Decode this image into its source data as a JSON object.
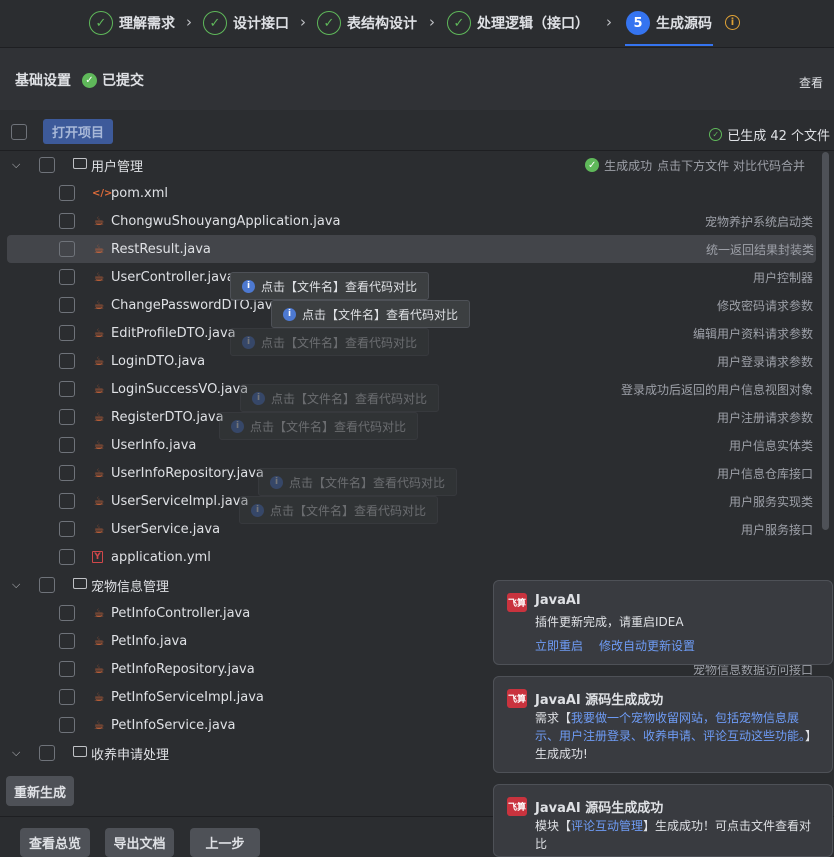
{
  "stepper": {
    "steps": [
      {
        "label": "理解需求",
        "state": "done"
      },
      {
        "label": "设计接口",
        "state": "done"
      },
      {
        "label": "表结构设计",
        "state": "done"
      },
      {
        "label": "处理逻辑（接口）",
        "state": "done"
      },
      {
        "label": "生成源码",
        "state": "active",
        "number": "5"
      }
    ],
    "check_glyph": "✓",
    "arrow_glyph": "›",
    "info_glyph": "i"
  },
  "settings": {
    "title": "基础设置",
    "status": "已提交",
    "view_link": "查看"
  },
  "toolbar": {
    "open_project": "打开项目",
    "generated_count": "已生成 42 个文件"
  },
  "groups": [
    {
      "name": "用户管理",
      "status": "生成成功",
      "hint": "点击下方文件 对比代码合并",
      "files": [
        {
          "name": "pom.xml",
          "type": "xml",
          "desc": ""
        },
        {
          "name": "ChongwuShouyangApplication.java",
          "type": "java",
          "desc": "宠物养护系统启动类"
        },
        {
          "name": "RestResult.java",
          "type": "java",
          "desc": "统一返回结果封装类",
          "selected": true
        },
        {
          "name": "UserController.java",
          "type": "java",
          "desc": "用户控制器"
        },
        {
          "name": "ChangePasswordDTO.java",
          "type": "java",
          "desc": "修改密码请求参数"
        },
        {
          "name": "EditProfileDTO.java",
          "type": "java",
          "desc": "编辑用户资料请求参数"
        },
        {
          "name": "LoginDTO.java",
          "type": "java",
          "desc": "用户登录请求参数"
        },
        {
          "name": "LoginSuccessVO.java",
          "type": "java",
          "desc": "登录成功后返回的用户信息视图对象"
        },
        {
          "name": "RegisterDTO.java",
          "type": "java",
          "desc": "用户注册请求参数"
        },
        {
          "name": "UserInfo.java",
          "type": "java",
          "desc": "用户信息实体类"
        },
        {
          "name": "UserInfoRepository.java",
          "type": "java",
          "desc": "用户信息仓库接口"
        },
        {
          "name": "UserServiceImpl.java",
          "type": "java",
          "desc": "用户服务实现类"
        },
        {
          "name": "UserService.java",
          "type": "java",
          "desc": "用户服务接口"
        },
        {
          "name": "application.yml",
          "type": "yml",
          "desc": ""
        }
      ]
    },
    {
      "name": "宠物信息管理",
      "files": [
        {
          "name": "PetInfoController.java",
          "type": "java",
          "desc": ""
        },
        {
          "name": "PetInfo.java",
          "type": "java",
          "desc": ""
        },
        {
          "name": "PetInfoRepository.java",
          "type": "java",
          "desc": "宠物信息数据访问接口"
        },
        {
          "name": "PetInfoServiceImpl.java",
          "type": "java",
          "desc": ""
        },
        {
          "name": "PetInfoService.java",
          "type": "java",
          "desc": ""
        }
      ]
    },
    {
      "name": "收养申请处理",
      "files": []
    }
  ],
  "tooltip_text": "点击【文件名】查看代码对比",
  "bottom": {
    "regenerate": "重新生成",
    "overview": "查看总览",
    "export_doc": "导出文档",
    "prev_step": "上一步"
  },
  "notifications": [
    {
      "logo": "飞算",
      "title": "JavaAI",
      "body": "插件更新完成，请重启IDEA",
      "links": [
        "立即重启",
        "修改自动更新设置"
      ]
    },
    {
      "logo": "飞算",
      "title": "JavaAI 源码生成成功",
      "body_prefix": "需求【",
      "body_highlight": "我要做一个宠物收留网站，包括宠物信息展示、用户注册登录、收养申请、评论互动这些功能。",
      "body_suffix": "】生成成功!"
    },
    {
      "logo": "飞算",
      "title": "JavaAI 源码生成成功",
      "body_prefix": "模块【",
      "body_highlight": "评论互动管理",
      "body_suffix": "】生成成功！可点击文件查看对比"
    }
  ],
  "colors": {
    "accent": "#3574f0",
    "success": "#5fb85a",
    "java_icon": "#e06c3a",
    "link": "#6e9cf6",
    "warning": "#e0a236"
  }
}
